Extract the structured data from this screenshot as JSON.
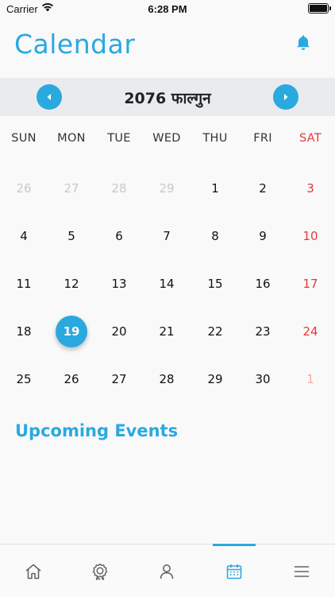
{
  "status_bar": {
    "carrier": "Carrier",
    "time": "6:28 PM"
  },
  "header": {
    "title": "Calendar"
  },
  "month": {
    "title": "2076 फाल्गुन"
  },
  "weekdays": [
    "SUN",
    "MON",
    "TUE",
    "WED",
    "THU",
    "FRI",
    "SAT"
  ],
  "weeks": [
    [
      "26",
      "27",
      "28",
      "29",
      "1",
      "2",
      "3"
    ],
    [
      "4",
      "5",
      "6",
      "7",
      "8",
      "9",
      "10"
    ],
    [
      "11",
      "12",
      "13",
      "14",
      "15",
      "16",
      "17"
    ],
    [
      "18",
      "19",
      "20",
      "21",
      "22",
      "23",
      "24"
    ],
    [
      "25",
      "26",
      "27",
      "28",
      "29",
      "30",
      "1"
    ]
  ],
  "selected_day": "19",
  "events": {
    "title": "Upcoming Events"
  },
  "tabs": [
    "home-icon",
    "award-icon",
    "profile-icon",
    "calendar-icon",
    "menu-icon"
  ],
  "active_tab": "calendar-icon",
  "colors": {
    "accent": "#2aa9df",
    "saturday": "#e53935"
  }
}
